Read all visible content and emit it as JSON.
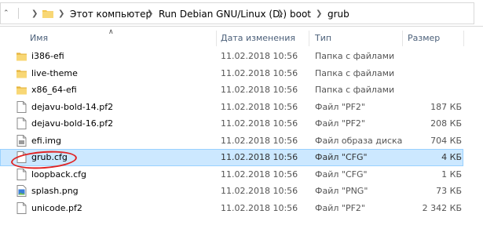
{
  "address_bar": {
    "breadcrumbs": [
      "Этот компьютер",
      "Run Debian GNU/Linux (D:)",
      "boot",
      "grub"
    ]
  },
  "columns": {
    "name": "Имя",
    "date": "Дата изменения",
    "type": "Тип",
    "size": "Размер",
    "sort_column": "name"
  },
  "files": [
    {
      "name": "i386-efi",
      "date": "11.02.2018 10:56",
      "type": "Папка с файлами",
      "size": "",
      "icon": "folder-icon"
    },
    {
      "name": "live-theme",
      "date": "11.02.2018 10:56",
      "type": "Папка с файлами",
      "size": "",
      "icon": "folder-icon"
    },
    {
      "name": "x86_64-efi",
      "date": "11.02.2018 10:56",
      "type": "Папка с файлами",
      "size": "",
      "icon": "folder-icon"
    },
    {
      "name": "dejavu-bold-14.pf2",
      "date": "11.02.2018 10:56",
      "type": "Файл \"PF2\"",
      "size": "187 КБ",
      "icon": "file-icon"
    },
    {
      "name": "dejavu-bold-16.pf2",
      "date": "11.02.2018 10:56",
      "type": "Файл \"PF2\"",
      "size": "208 КБ",
      "icon": "file-icon"
    },
    {
      "name": "efi.img",
      "date": "11.02.2018 10:56",
      "type": "Файл образа диска",
      "size": "704 КБ",
      "icon": "disk-image-icon"
    },
    {
      "name": "grub.cfg",
      "date": "11.02.2018 10:56",
      "type": "Файл \"CFG\"",
      "size": "4 КБ",
      "icon": "file-icon",
      "selected": true
    },
    {
      "name": "loopback.cfg",
      "date": "11.02.2018 10:56",
      "type": "Файл \"CFG\"",
      "size": "1 КБ",
      "icon": "file-icon"
    },
    {
      "name": "splash.png",
      "date": "11.02.2018 10:56",
      "type": "Файл \"PNG\"",
      "size": "73 КБ",
      "icon": "image-file-icon"
    },
    {
      "name": "unicode.pf2",
      "date": "11.02.2018 10:56",
      "type": "Файл \"PF2\"",
      "size": "2 342 КБ",
      "icon": "file-icon"
    }
  ],
  "colors": {
    "selection_bg": "#cce8ff",
    "selection_border": "#99d1ff",
    "header_text": "#4c607a",
    "annotation_circle": "#e02424",
    "folder_yellow": "#f4c74f"
  },
  "icons": {
    "up_chevron": "chevron-up-icon",
    "path_separator": "chevron-right-icon",
    "sort_indicator": "sort-up-icon"
  }
}
